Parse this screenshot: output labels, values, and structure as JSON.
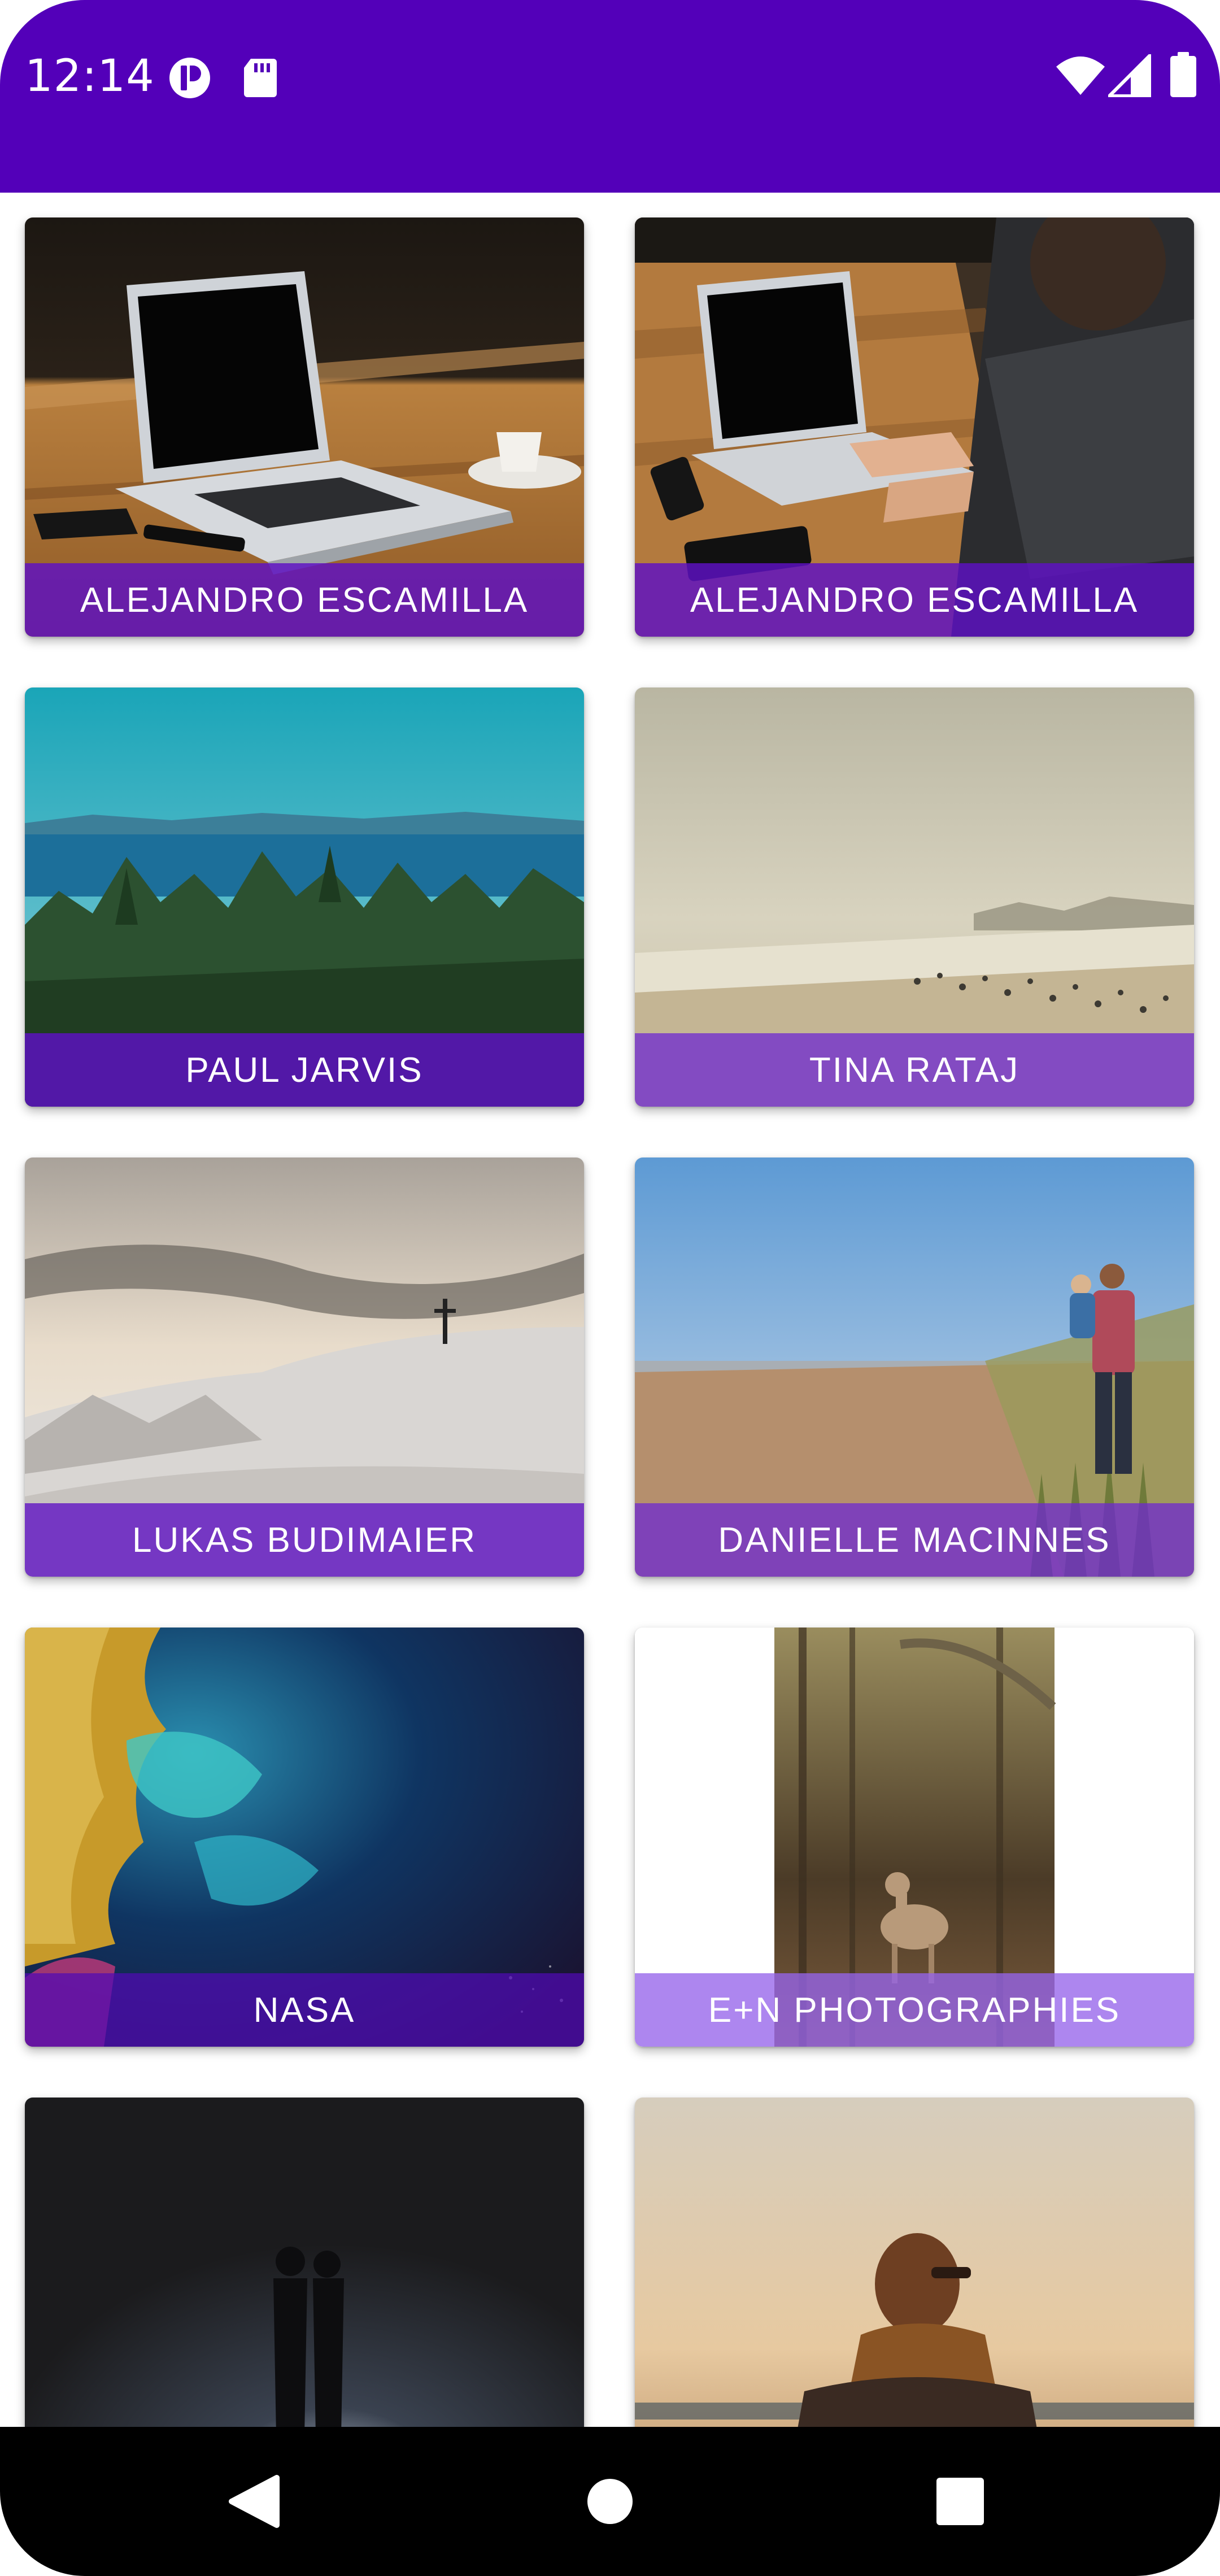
{
  "status_bar": {
    "time": "12:14",
    "background": "#5300b9",
    "left_icons": [
      "notification-app-icon",
      "sd-card-icon"
    ],
    "right_icons": [
      "wifi-icon",
      "cellular-signal-icon",
      "battery-icon"
    ]
  },
  "gallery": {
    "caption_colors": {
      "dark": "#6a20c7",
      "light": "#a77ef0"
    },
    "cards": [
      {
        "author": "ALEJANDRO ESCAMILLA",
        "scene": "laptop on wooden table"
      },
      {
        "author": "ALEJANDRO ESCAMILLA",
        "scene": "person typing on laptop"
      },
      {
        "author": "PAUL JARVIS",
        "scene": "forest and sea"
      },
      {
        "author": "TINA RATAJ",
        "scene": "misty beach"
      },
      {
        "author": "LUKAS BUDIMAIER",
        "scene": "snowy hill with cross"
      },
      {
        "author": "DANIELLE MACINNES",
        "scene": "man carrying child on beach"
      },
      {
        "author": "NASA",
        "scene": "earth from space"
      },
      {
        "author": "E+N PHOTOGRAPHIES",
        "scene": "fawn in forest"
      },
      {
        "author": "",
        "scene": "couple in rain at night"
      },
      {
        "author": "",
        "scene": "person with scarf at sunset"
      }
    ]
  },
  "navigation": {
    "back": "back-icon",
    "home": "home-icon",
    "recents": "recents-icon"
  }
}
